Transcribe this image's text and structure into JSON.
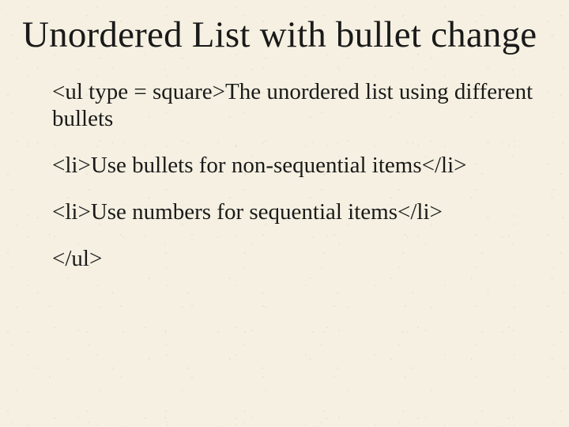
{
  "title": "Unordered List with bullet change",
  "lines": [
    "<ul type = square>The unordered list using different bullets",
    "<li>Use bullets for non-sequential items</li>",
    "<li>Use numbers for sequential items</li>",
    "</ul>"
  ]
}
